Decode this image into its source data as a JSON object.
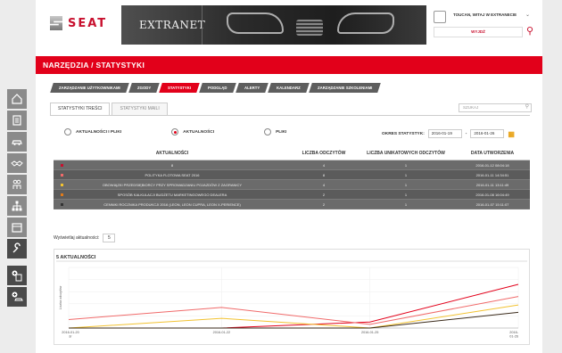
{
  "header": {
    "brand": "SEAT",
    "hero_title": "EXTRANET",
    "user_name": "TOUCAN, WITAJ W EXTRANECIE",
    "logout_label": "WYJDŹ"
  },
  "page_title": "NARZĘDZIA / STATYSTYKI",
  "tabs": [
    {
      "label": "ZARZĄDZANIE UŻYTKOWNIKAMI",
      "active": false
    },
    {
      "label": "ZGODY",
      "active": false
    },
    {
      "label": "STATYSTYKI",
      "active": true
    },
    {
      "label": "PODGLĄD",
      "active": false
    },
    {
      "label": "ALERTY",
      "active": false
    },
    {
      "label": "KALENDARZ",
      "active": false
    },
    {
      "label": "ZARZĄDZANIE SZKOLENIAMI",
      "active": false
    }
  ],
  "subtabs": [
    {
      "label": "STATYSTYKI TREŚCI",
      "active": true
    },
    {
      "label": "STATYSTYKI MAILI",
      "active": false
    }
  ],
  "search": {
    "placeholder": "SZUKAJ"
  },
  "radios": [
    {
      "label": "AKTUALNOŚCI I PLIKI",
      "checked": false
    },
    {
      "label": "AKTUALNOŚCI",
      "checked": true
    },
    {
      "label": "PLIKI",
      "checked": false
    }
  ],
  "period": {
    "label": "OKRES STATYSTYK:",
    "from": "2016-01-19",
    "sep": "-",
    "to": "2016-01-26"
  },
  "table": {
    "headers": [
      "AKTUALNOŚCI",
      "LICZBA ODCZYTÓW",
      "LICZBA UNIKATOWYCH ODCZYTÓW",
      "DATA UTWORZENIA"
    ],
    "rows": [
      {
        "color": "#c8102e",
        "title": "8",
        "reads": "4",
        "unique": "1",
        "date": "2016-01-12 08:04:18"
      },
      {
        "color": "#f06a6a",
        "title": "POLITYKA FLOTOWA SEAT 2016",
        "reads": "8",
        "unique": "1",
        "date": "2016-01-11 14:34:51"
      },
      {
        "color": "#f2c230",
        "title": "OBOWIĄZKI PRZEDSIĘBIORCY PRZY SPROWADZANIU POJAZDÓW Z ZAGRANICY",
        "reads": "4",
        "unique": "1",
        "date": "2016-01-11 13:11:49"
      },
      {
        "color": "#e07b1a",
        "title": "SPOSÓB KALKULACJI BUDŻETU MARKETINGOWEGO DEALERA",
        "reads": "2",
        "unique": "1",
        "date": "2016-01-08 16:04:49"
      },
      {
        "color": "#333333",
        "title": "CENNIKI ROCZNIKA PRODUKCJI 2016 (LEON, LEON CUPRA, LEON X-PERIENCE)",
        "reads": "2",
        "unique": "1",
        "date": "2016-01-07 15:11:07"
      }
    ]
  },
  "show_count": {
    "label": "Wyświetlaj aktualności:",
    "value": "5"
  },
  "chart_data": {
    "type": "line",
    "title": "5 AKTUALNOŚCI",
    "ylabel": "Liczba odczytów",
    "x": [
      "2016-01-20",
      "2016-01-22",
      "2016-01-25",
      "2016-01-26"
    ],
    "tick_labels": [
      "2016-01-20\nśr",
      "2016-01-22",
      "2016-01-25",
      "2016-\n01-26"
    ],
    "ylim": [
      0,
      5
    ],
    "series": [
      {
        "color": "#e2001a",
        "values": [
          0,
          0,
          0.5,
          3.6
        ]
      },
      {
        "color": "#f06a6a",
        "values": [
          0.7,
          1.7,
          0.3,
          2.6
        ]
      },
      {
        "color": "#f2c230",
        "values": [
          0,
          0.8,
          0,
          1.9
        ]
      },
      {
        "color": "#3a2a1a",
        "values": [
          0,
          0,
          0,
          1.3
        ]
      }
    ]
  }
}
